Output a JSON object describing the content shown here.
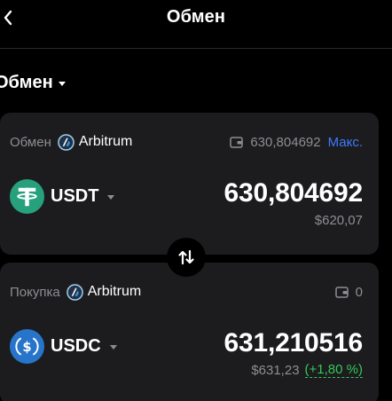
{
  "header": {
    "title": "Обмен",
    "back_icon": "chevron-left-icon"
  },
  "mode": {
    "label": "Обмен"
  },
  "sell": {
    "op_label": "Обмен",
    "network": "Arbitrum",
    "network_icon": "arbitrum-icon",
    "wallet_icon": "wallet-icon",
    "balance": "630,804692",
    "max_label": "Макс.",
    "token": "USDT",
    "token_icon": "tether-icon",
    "amount": "630,804692",
    "fiat": "$620,07"
  },
  "buy": {
    "op_label": "Покупка",
    "network": "Arbitrum",
    "network_icon": "arbitrum-icon",
    "wallet_icon": "wallet-icon",
    "balance": "0",
    "token": "USDC",
    "token_icon": "usdc-icon",
    "amount": "631,210516",
    "fiat": "$631,23",
    "change": "(+1,80 %)"
  },
  "swap_icon": "swap-arrows-icon",
  "colors": {
    "background": "#000000",
    "card": "#1c1c1e",
    "muted": "#8e8e93",
    "accent": "#3d7bff",
    "positive": "#34c759",
    "tether": "#26a17b",
    "usdc": "#2775ca"
  }
}
